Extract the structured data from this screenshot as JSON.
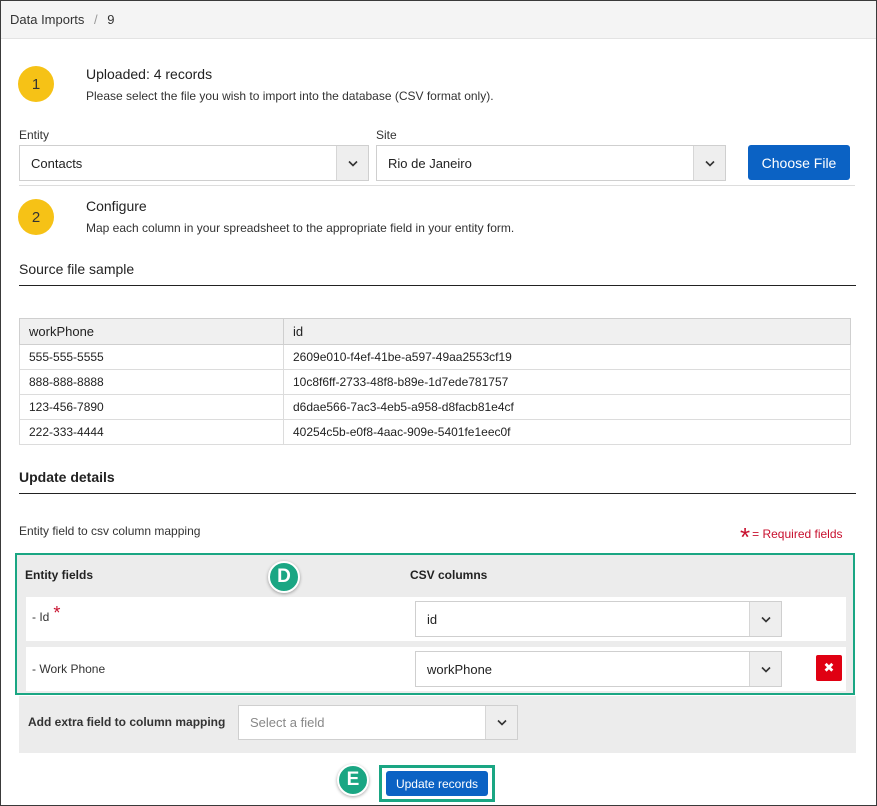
{
  "breadcrumb": {
    "root": "Data Imports",
    "separator": "/",
    "current": "9"
  },
  "step1": {
    "number": "1",
    "title": "Uploaded: 4 records",
    "description": "Please select the file you wish to import into the database (CSV format only)."
  },
  "entity": {
    "label": "Entity",
    "value": "Contacts"
  },
  "site": {
    "label": "Site",
    "value": "Rio de Janeiro"
  },
  "choose_file_label": "Choose File",
  "step2": {
    "number": "2",
    "title": "Configure",
    "description": "Map each column in your spreadsheet to the appropriate field in your entity form."
  },
  "source_sample": {
    "title": "Source file sample",
    "headers": [
      "workPhone",
      "id"
    ],
    "rows": [
      [
        "555-555-5555",
        "2609e010-f4ef-41be-a597-49aa2553cf19"
      ],
      [
        "888-888-8888",
        "10c8f6ff-2733-48f8-b89e-1d7ede781757"
      ],
      [
        "123-456-7890",
        "d6dae566-7ac3-4eb5-a958-d8facb81e4cf"
      ],
      [
        "222-333-4444",
        "40254c5b-e0f8-4aac-909e-5401fe1eec0f"
      ]
    ]
  },
  "update_details": {
    "title": "Update details",
    "mapping_label": "Entity field to csv column mapping",
    "required_note": "= Required fields",
    "required_mark": "*"
  },
  "mapping": {
    "head_entity": "Entity fields",
    "head_csv": "CSV columns",
    "rows": [
      {
        "field": "- Id",
        "required": true,
        "column": "id"
      },
      {
        "field": "- Work Phone",
        "required": false,
        "column": "workPhone"
      }
    ]
  },
  "extra": {
    "label": "Add extra field to column mapping",
    "placeholder": "Select a field"
  },
  "update_button_label": "Update records",
  "markers": {
    "d": "D",
    "e": "E"
  },
  "colors": {
    "accent": "#1aa683",
    "primary": "#0b62c4",
    "step": "#f6c216",
    "danger": "#e00012",
    "required": "#c8102e"
  }
}
